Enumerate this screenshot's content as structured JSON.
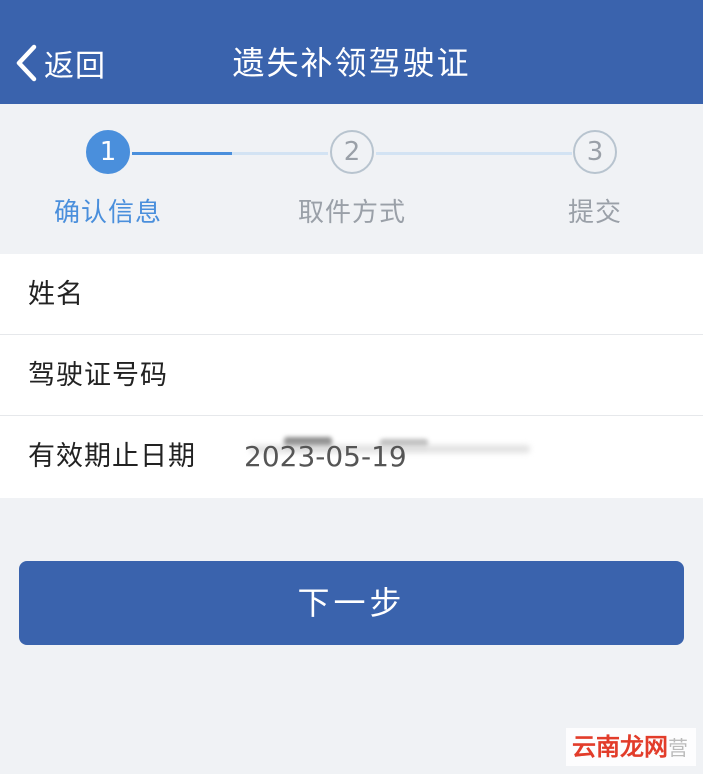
{
  "header": {
    "back_label": "返回",
    "title": "遗失补领驾驶证"
  },
  "steps": [
    {
      "number": "1",
      "label": "确认信息",
      "state": "active"
    },
    {
      "number": "2",
      "label": "取件方式",
      "state": "inactive"
    },
    {
      "number": "3",
      "label": "提交",
      "state": "inactive"
    }
  ],
  "info": {
    "rows": [
      {
        "label": "姓名",
        "value": ""
      },
      {
        "label": "驾驶证号码",
        "value": ""
      },
      {
        "label": "有效期止日期",
        "value": "2023-05-19"
      }
    ]
  },
  "actions": {
    "next_label": "下一步"
  },
  "watermark": {
    "text": "云南龙网",
    "tail": "营"
  },
  "colors": {
    "brand": "#3a63ad",
    "active_step": "#4a8fdc",
    "inactive_step": "#9aa0a8",
    "background": "#f0f2f5"
  }
}
